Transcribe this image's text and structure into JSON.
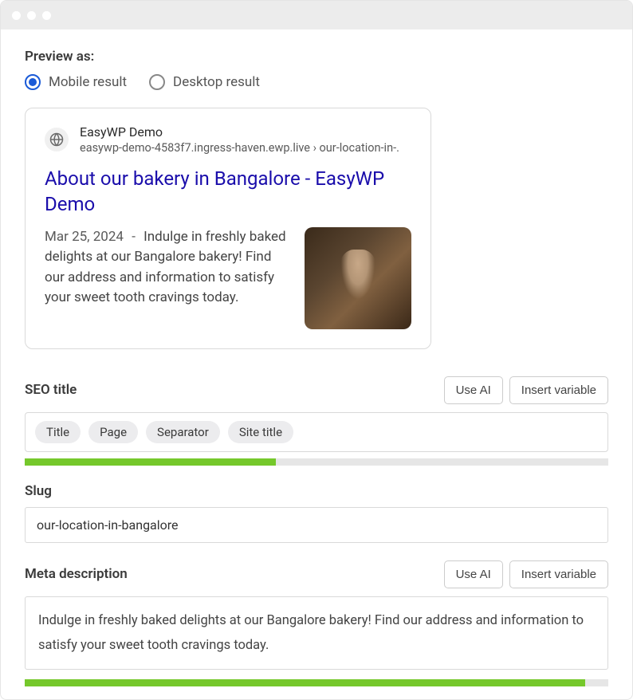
{
  "previewAs": {
    "label": "Preview as:",
    "options": {
      "mobile": "Mobile result",
      "desktop": "Desktop result"
    },
    "selected": "mobile"
  },
  "preview": {
    "siteName": "EasyWP Demo",
    "url": "easywp-demo-4583f7.ingress-haven.ewp.live › our-location-in-.",
    "title": "About our bakery in Bangalore - EasyWP Demo",
    "date": "Mar 25, 2024",
    "separator": "-",
    "description": "Indulge in freshly baked delights at our Bangalore bakery! Find our address and information to satisfy your sweet tooth cravings today."
  },
  "seoTitle": {
    "label": "SEO title",
    "useAI": "Use AI",
    "insertVariable": "Insert variable",
    "pills": [
      "Title",
      "Page",
      "Separator",
      "Site title"
    ],
    "progressPercent": 43
  },
  "slug": {
    "label": "Slug",
    "value": "our-location-in-bangalore"
  },
  "metaDescription": {
    "label": "Meta description",
    "useAI": "Use AI",
    "insertVariable": "Insert variable",
    "value": "Indulge in freshly baked delights at our Bangalore bakery! Find our address and information to satisfy your sweet tooth cravings today.",
    "progressPercent": 96
  }
}
